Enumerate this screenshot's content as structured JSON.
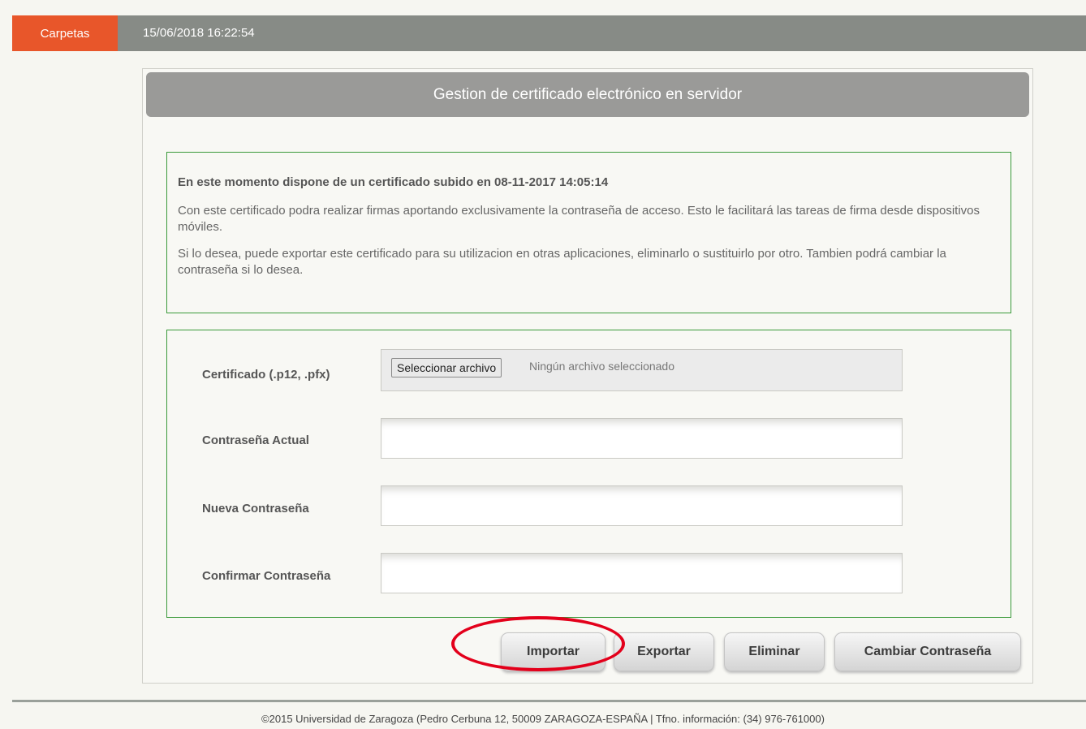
{
  "topbar": {
    "tab_label": "Carpetas",
    "datetime": "15/06/2018 16:22:54"
  },
  "panel": {
    "title": "Gestion de certificado electrónico en servidor"
  },
  "info": {
    "title": "En este momento dispone de un certificado subido en 08-11-2017 14:05:14",
    "paragraph1": "Con este certificado podra realizar firmas aportando exclusivamente la contraseña de acceso. Esto le facilitará las tareas de firma desde dispositivos móviles.",
    "paragraph2": "Si lo desea, puede exportar este certificado para su utilizacion en otras aplicaciones, eliminarlo o sustituirlo por otro. Tambien podrá cambiar la contraseña si lo desea."
  },
  "form": {
    "certificate_label": "Certificado (.p12, .pfx)",
    "file_button_label": "Seleccionar archivo",
    "file_status": "Ningún archivo seleccionado",
    "current_password_label": "Contraseña Actual",
    "current_password_value": "",
    "new_password_label": "Nueva Contraseña",
    "new_password_value": "",
    "confirm_password_label": "Confirmar Contraseña",
    "confirm_password_value": ""
  },
  "actions": {
    "import_label": "Importar",
    "export_label": "Exportar",
    "delete_label": "Eliminar",
    "change_password_label": "Cambiar Contraseña"
  },
  "footer": {
    "text": "©2015 Universidad de Zaragoza (Pedro Cerbuna 12, 50009 ZARAGOZA-ESPAÑA | Tfno. información: (34) 976-761000)"
  },
  "colors": {
    "accent": "#e8562a",
    "topbar": "#878b86",
    "panel_header": "#9a9a98",
    "box_border": "#3a9a3a",
    "highlight_ring": "#e3001b"
  }
}
